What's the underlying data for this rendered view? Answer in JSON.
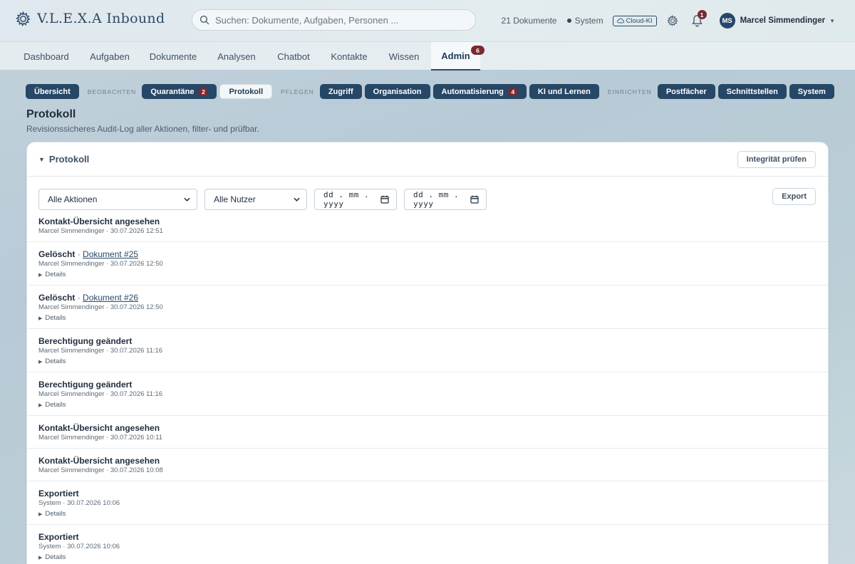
{
  "brand": {
    "name": "V.L.E.X.A Inbound",
    "logo_icon": "gear-flower-icon"
  },
  "search": {
    "placeholder": "Suchen: Dokumente, Aufgaben, Personen ..."
  },
  "header": {
    "doc_count": "21 Dokumente",
    "system_status": "System",
    "cloud_badge": "Cloud-KI",
    "notifications_count": "1",
    "user_initials": "MS",
    "user_name": "Marcel Simmendinger"
  },
  "main_nav": {
    "tabs": [
      {
        "label": "Dashboard"
      },
      {
        "label": "Aufgaben"
      },
      {
        "label": "Dokumente"
      },
      {
        "label": "Analysen"
      },
      {
        "label": "Chatbot"
      },
      {
        "label": "Kontakte"
      },
      {
        "label": "Wissen"
      },
      {
        "label": "Admin",
        "badge": "6",
        "active": true
      }
    ]
  },
  "sub_nav": {
    "overview": "Übersicht",
    "group_observe": "BEOBACHTEN",
    "quarantine": "Quarantäne",
    "quarantine_count": "2",
    "protocol": "Protokoll",
    "group_maintain": "PFLEGEN",
    "access": "Zugriff",
    "organisation": "Organisation",
    "automation": "Automatisierung",
    "automation_count": "4",
    "ai_learning": "KI und Lernen",
    "group_setup": "EINRICHTEN",
    "mailboxes": "Postfächer",
    "interfaces": "Schnittstellen",
    "system": "System"
  },
  "page": {
    "title": "Protokoll",
    "subtitle": "Revisionssicheres Audit-Log aller Aktionen, filter- und prüfbar."
  },
  "card": {
    "title": "Protokoll",
    "verify_button": "Integrität prüfen",
    "filters": {
      "action_select": "Alle Aktionen",
      "user_select": "Alle Nutzer",
      "date_from": "dd . mm . yyyy",
      "date_to": "dd . mm . yyyy",
      "export_button": "Export"
    },
    "details_label": "Details",
    "entries": [
      {
        "action": "Kontakt-Übersicht angesehen",
        "link": "",
        "meta": "Marcel Simmendinger · 30.07.2026 12:51",
        "details": false
      },
      {
        "action": "Gelöscht",
        "link": "Dokument #25",
        "meta": "Marcel Simmendinger · 30.07.2026 12:50",
        "details": true
      },
      {
        "action": "Gelöscht",
        "link": "Dokument #26",
        "meta": "Marcel Simmendinger · 30.07.2026 12:50",
        "details": true
      },
      {
        "action": "Berechtigung geändert",
        "link": "",
        "meta": "Marcel Simmendinger · 30.07.2026 11:16",
        "details": true
      },
      {
        "action": "Berechtigung geändert",
        "link": "",
        "meta": "Marcel Simmendinger · 30.07.2026 11:16",
        "details": true
      },
      {
        "action": "Kontakt-Übersicht angesehen",
        "link": "",
        "meta": "Marcel Simmendinger · 30.07.2026 10:11",
        "details": false
      },
      {
        "action": "Kontakt-Übersicht angesehen",
        "link": "",
        "meta": "Marcel Simmendinger · 30.07.2026 10:08",
        "details": false
      },
      {
        "action": "Exportiert",
        "link": "",
        "meta": "System · 30.07.2026 10:06",
        "details": true
      },
      {
        "action": "Exportiert",
        "link": "",
        "meta": "System · 30.07.2026 10:06",
        "details": true
      }
    ]
  },
  "colors": {
    "primary": "#264766",
    "badge": "#7a2a33",
    "background": "#bccfd8"
  }
}
